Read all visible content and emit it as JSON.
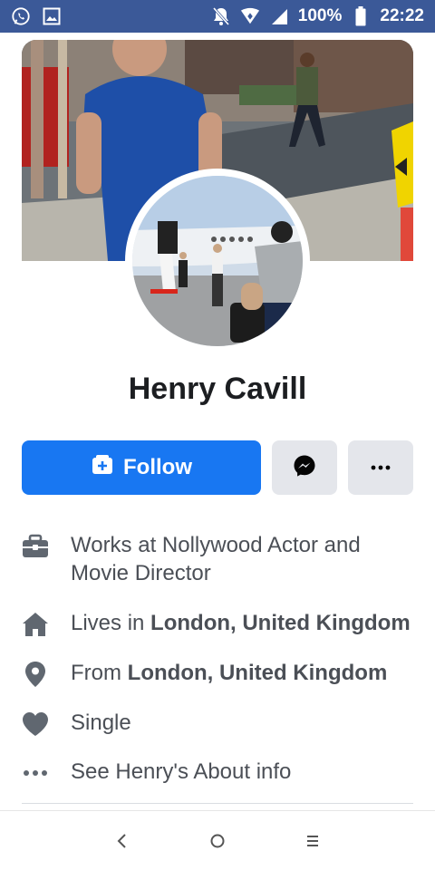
{
  "status_bar": {
    "battery": "100%",
    "time": "22:22",
    "icons": [
      "whatsapp-icon",
      "gallery-icon",
      "mute-icon",
      "data-icon",
      "signal-icon",
      "battery-icon"
    ]
  },
  "profile": {
    "name": "Henry Cavill"
  },
  "actions": {
    "follow_label": "Follow",
    "messenger_icon": "messenger-icon",
    "more_icon": "more-icon"
  },
  "details": {
    "work": "Works at Nollywood Actor and Movie Director",
    "lives_prefix": "Lives in ",
    "lives_place": "London, United Kingdom",
    "from_prefix": "From ",
    "from_place": "London, United Kingdom",
    "relationship": "Single",
    "about_link": "See Henry's About info"
  },
  "colors": {
    "status_bar": "#3b5998",
    "follow_button": "#1877f2",
    "secondary_button": "#e4e6eb",
    "detail_icon": "#606770"
  }
}
